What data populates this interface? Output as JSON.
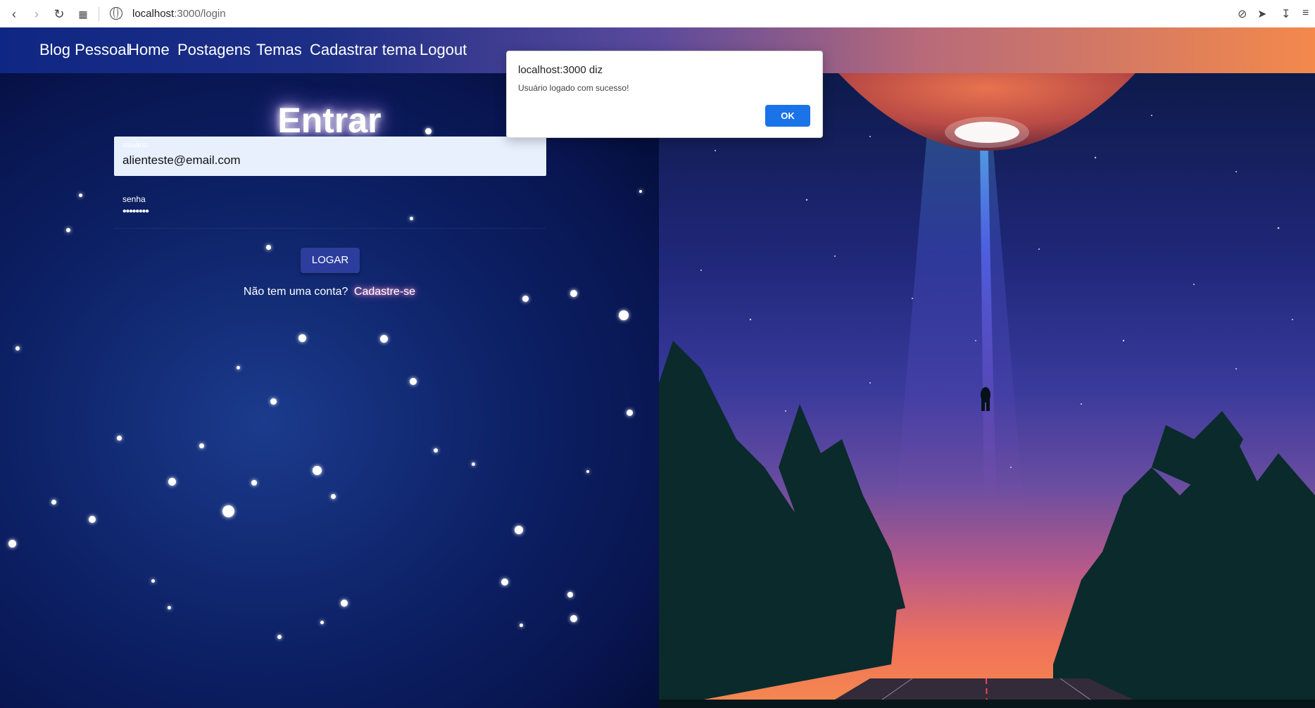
{
  "browser": {
    "url_host": "localhost",
    "url_path": ":3000/login"
  },
  "navbar": {
    "items": [
      {
        "label": "Blog Pessoal"
      },
      {
        "label": "Home"
      },
      {
        "label": "Postagens"
      },
      {
        "label": "Temas"
      },
      {
        "label": "Cadastrar tema"
      },
      {
        "label": "Logout"
      }
    ]
  },
  "login": {
    "title": "Entrar",
    "user_label": "usuário",
    "user_value": "alienteste@email.com",
    "pass_label": "senha",
    "pass_value": "••••••••",
    "submit_label": "LOGAR",
    "no_account_text": "Não tem uma conta?",
    "signup_link": "Cadastre-se"
  },
  "dialog": {
    "title": "localhost:3000 diz",
    "message": "Usuário logado com sucesso!",
    "ok_label": "OK"
  },
  "colors": {
    "accent": "#1a73e8",
    "login_button": "#2c3d9e"
  }
}
